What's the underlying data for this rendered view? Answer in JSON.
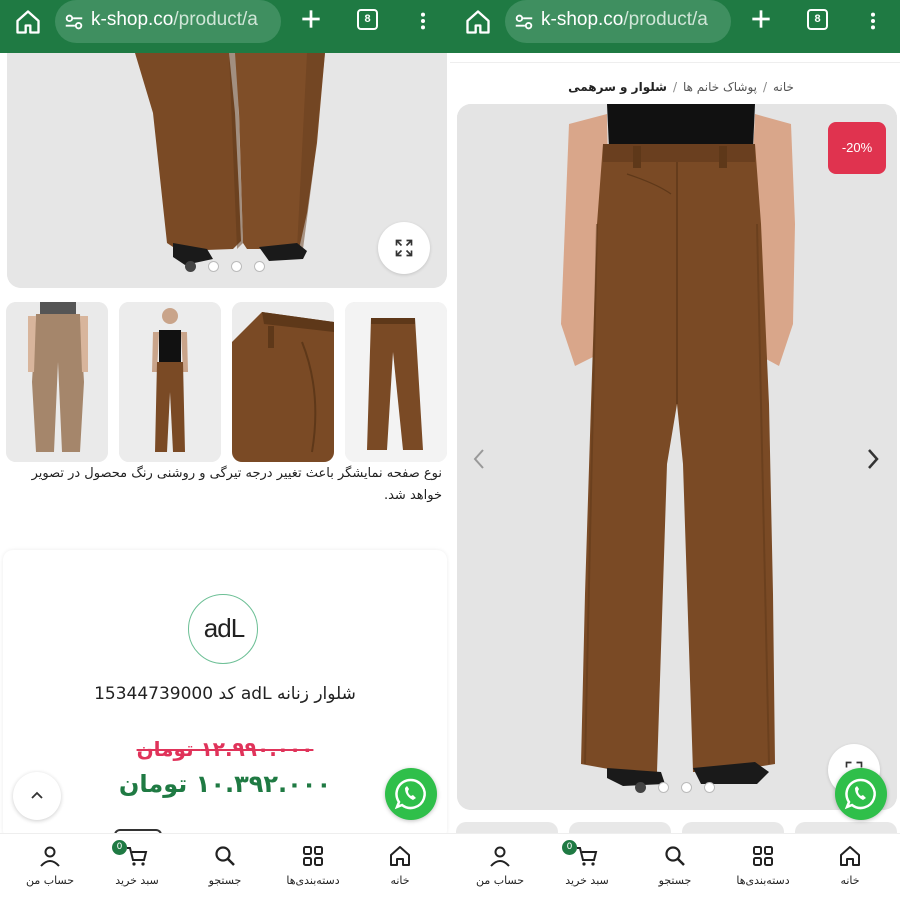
{
  "browser": {
    "url_domain": "k-shop.co",
    "url_path": "/product/a",
    "tab_count": "8"
  },
  "left": {
    "note_text": "نوع صفحه نمایشگر باعث تغییر درجه تیرگی و روشنی رنگ محصول در تصویر خواهد شد.",
    "brand_logo_text": "adL",
    "product_title": "شلوار زنانه adL کد 15344739000",
    "old_price": "۱۲.۹۹۰.۰۰۰ تومان",
    "new_price": "۱۰.۳۹۲.۰۰۰ تومان",
    "carousel_active_index": 1,
    "carousel_count": 4
  },
  "right": {
    "breadcrumb": {
      "home": "خانه",
      "category": "پوشاک خانم ها",
      "current": "شلوار و سرهمی"
    },
    "discount_badge": "-20%",
    "carousel_active_index": 1,
    "carousel_count": 4
  },
  "nav": {
    "home": "خانه",
    "categories": "دسته‌بندی‌ها",
    "search": "جستجو",
    "cart": "سبد خرید",
    "cart_count": "0",
    "account": "حساب من"
  },
  "colors": {
    "brand_green": "#1f7a43",
    "discount_red": "#e0334f",
    "old_price": "#e0335a",
    "pants_brown": "#7a4a25"
  }
}
